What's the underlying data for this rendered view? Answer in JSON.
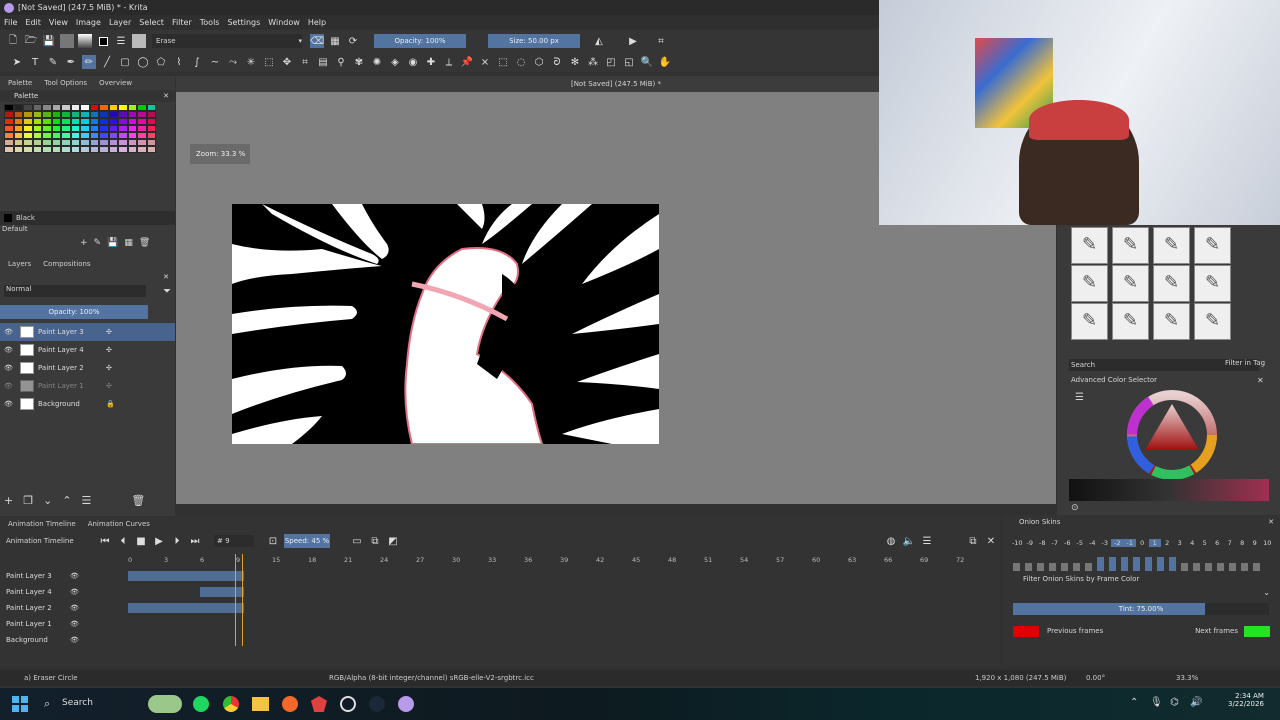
{
  "window": {
    "title": "[Not Saved]  (247.5 MiB) * - Krita"
  },
  "menu": [
    "File",
    "Edit",
    "View",
    "Image",
    "Layer",
    "Select",
    "Filter",
    "Tools",
    "Settings",
    "Window",
    "Help"
  ],
  "toolbar": {
    "preset": "Erase",
    "opacity": "Opacity: 100%",
    "size": "Size: 50.00 px"
  },
  "canvas": {
    "tab_title": "[Not Saved]  (247.5 MiB) *",
    "zoom_overlay": "Zoom: 33.3 %"
  },
  "left": {
    "tabs": [
      "Palette",
      "Tool Options",
      "Overview"
    ],
    "palette_title": "Palette",
    "color_name": "Black",
    "palette_name": "Default",
    "layers_tabs": [
      "Layers",
      "Compositions"
    ],
    "blend_mode": "Normal",
    "opacity": "Opacity:  100%",
    "layers": [
      {
        "name": "Paint Layer 3",
        "selected": true
      },
      {
        "name": "Paint Layer 4",
        "selected": false
      },
      {
        "name": "Paint Layer 2",
        "selected": false
      },
      {
        "name": "Paint Layer 1",
        "selected": false,
        "dim": true
      },
      {
        "name": "Background",
        "selected": false
      }
    ]
  },
  "right": {
    "search_placeholder": "Search",
    "filter_in_tag": "Filter in Tag",
    "color_selector_title": "Advanced Color Selector"
  },
  "animation": {
    "tabs": [
      "Animation Timeline",
      "Animation Curves"
    ],
    "title": "Animation Timeline",
    "frame": "9",
    "speed": "Speed: 45 %",
    "ruler": [
      "0",
      "3",
      "6",
      "9",
      "15",
      "18",
      "21",
      "24",
      "27",
      "30",
      "33",
      "36",
      "39",
      "42",
      "45",
      "48",
      "51",
      "54",
      "57",
      "60",
      "63",
      "66",
      "69",
      "72"
    ],
    "layers": [
      "Paint Layer 3",
      "Paint Layer 4",
      "Paint Layer 2",
      "Paint Layer 1",
      "Background"
    ]
  },
  "onion": {
    "title": "Onion Skins",
    "numbers": [
      "-10",
      "-9",
      "-8",
      "-7",
      "-6",
      "-5",
      "-4",
      "-3",
      "-2",
      "-1",
      "0",
      "1",
      "2",
      "3",
      "4",
      "5",
      "6",
      "7",
      "8",
      "9",
      "10"
    ],
    "filter": "Filter Onion Skins by Frame Color",
    "tint": "Tint: 75.00%",
    "tint_value": 0.75,
    "previous": "Previous frames",
    "next": "Next frames",
    "prev_color": "#e00000",
    "next_color": "#22e422"
  },
  "status": {
    "tool": "a) Eraser Circle",
    "colorspace": "RGB/Alpha (8-bit integer/channel)  sRGB-elle-V2-srgbtrc.icc",
    "dims": "1,920 x 1,080 (247.5 MiB)",
    "rotation": "0.00°",
    "zoom": "33.3%"
  },
  "taskbar": {
    "search": "Search",
    "time": "2:34 AM",
    "date": "3/22/2026"
  }
}
